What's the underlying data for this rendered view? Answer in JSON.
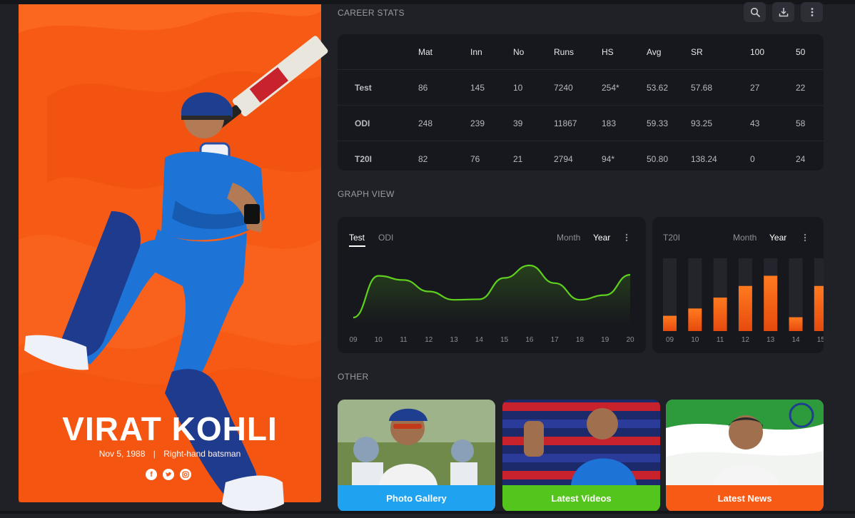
{
  "player": {
    "name": "VIRAT KOHLI",
    "dob": "Nov 5, 1988",
    "role": "Right-hand batsman",
    "socials": [
      "facebook-icon",
      "twitter-icon",
      "instagram-icon"
    ],
    "brand_color": "#f75a14"
  },
  "career_stats": {
    "title": "CAREER STATS",
    "columns": [
      "",
      "Mat",
      "Inn",
      "No",
      "Runs",
      "HS",
      "Avg",
      "SR",
      "100",
      "50"
    ],
    "rows": [
      {
        "format": "Test",
        "color": "#5fd01e",
        "values": [
          "86",
          "145",
          "10",
          "7240",
          "254*",
          "53.62",
          "57.68",
          "27",
          "22"
        ]
      },
      {
        "format": "ODI",
        "color": "#2da7f1",
        "values": [
          "248",
          "239",
          "39",
          "11867",
          "183",
          "59.33",
          "93.25",
          "43",
          "58"
        ]
      },
      {
        "format": "T20I",
        "color": "#f76a1d",
        "values": [
          "82",
          "76",
          "21",
          "2794",
          "94*",
          "50.80",
          "138.24",
          "0",
          "24"
        ]
      }
    ],
    "actions": [
      "search-icon",
      "download-icon",
      "more-icon"
    ]
  },
  "graph_view": {
    "title": "GRAPH VIEW",
    "left": {
      "tabs": [
        "Test",
        "ODI"
      ],
      "active_tab": "Test",
      "periods": [
        "Month",
        "Year"
      ],
      "active_period": "Year",
      "line_color": "#5fd01e"
    },
    "right": {
      "tab": "T20I",
      "periods": [
        "Month",
        "Year"
      ],
      "active_period": "Year",
      "bar_color": "#f7731f"
    }
  },
  "chart_data": [
    {
      "type": "line",
      "x": [
        "09",
        "10",
        "11",
        "12",
        "13",
        "14",
        "15",
        "16",
        "17",
        "18",
        "19",
        "20"
      ],
      "values": [
        0.0,
        0.8,
        0.72,
        0.5,
        0.34,
        0.35,
        0.76,
        1.0,
        0.66,
        0.34,
        0.43,
        0.82
      ],
      "ylim": [
        0,
        1
      ]
    },
    {
      "type": "bar",
      "categories": [
        "09",
        "10",
        "11",
        "12",
        "13",
        "14",
        "15"
      ],
      "values": [
        0.21,
        0.31,
        0.46,
        0.62,
        0.76,
        0.19,
        0.62
      ],
      "ylim": [
        0,
        1
      ]
    }
  ],
  "other": {
    "title": "OTHER",
    "cards": [
      {
        "label": "Photo Gallery",
        "color": "#1fa3f0"
      },
      {
        "label": "Latest Videos",
        "color": "#53c51c"
      },
      {
        "label": "Latest News",
        "color": "#f75a14"
      }
    ]
  }
}
